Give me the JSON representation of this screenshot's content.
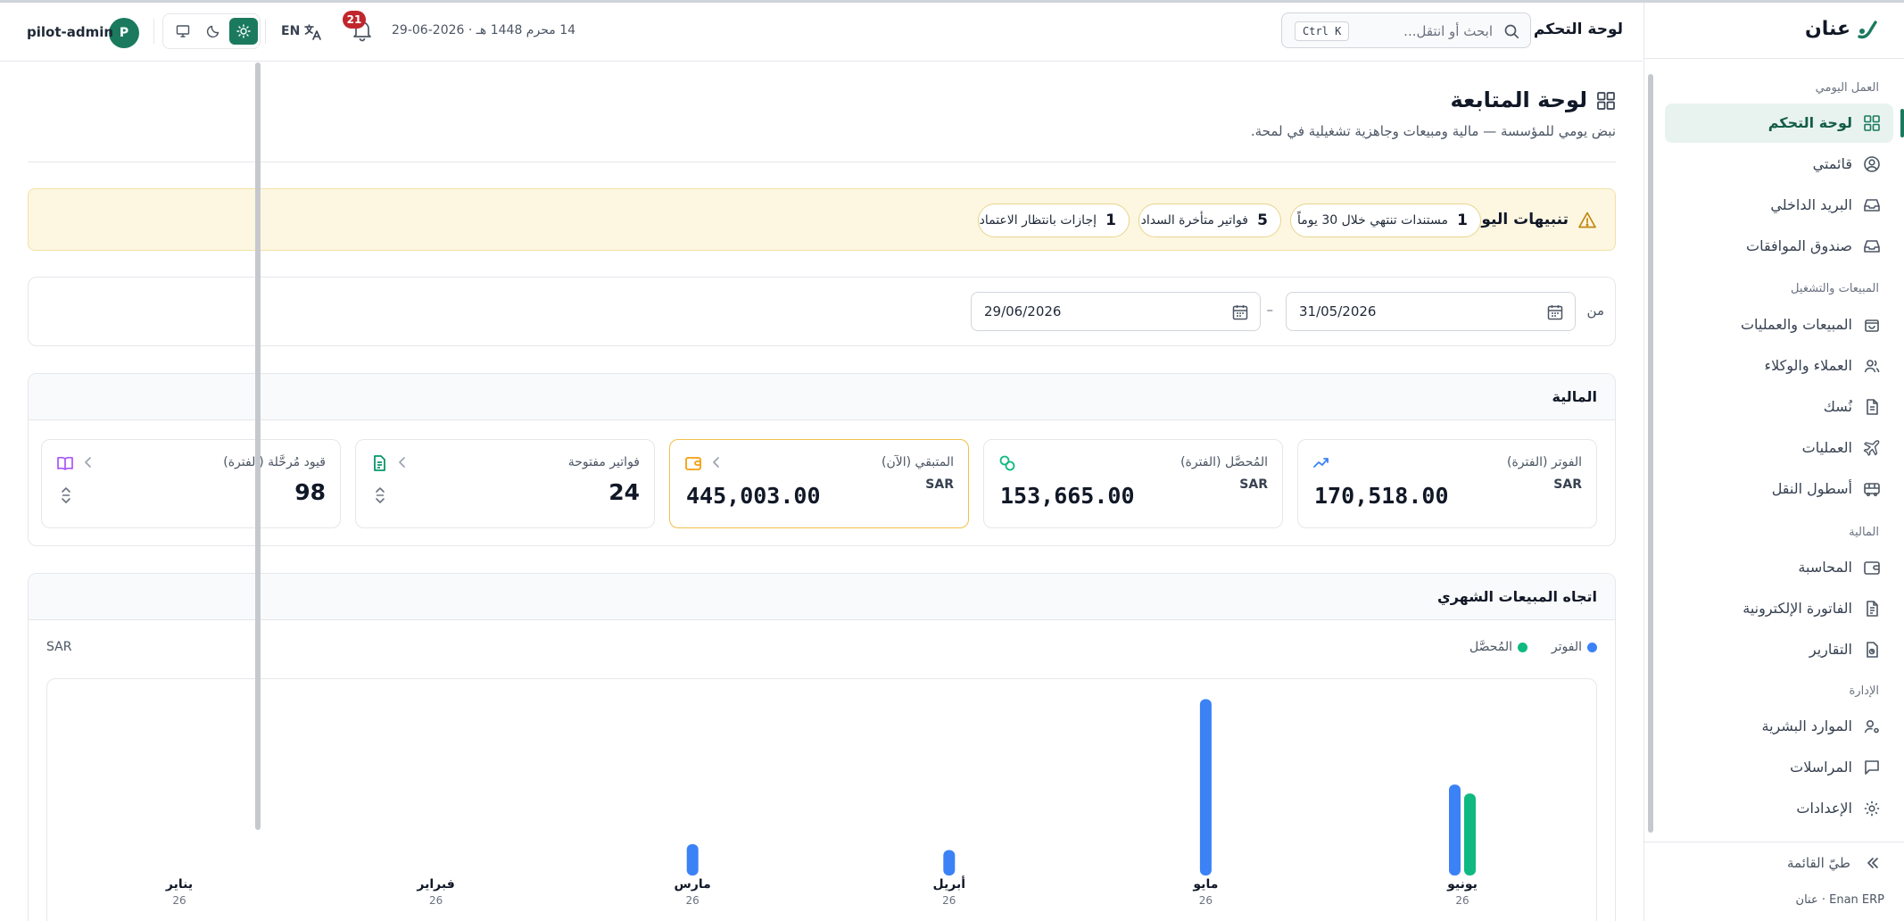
{
  "brand": {
    "name": "عنان",
    "footer": "Enan ERP · عنان"
  },
  "sidebar": {
    "sections": [
      {
        "title": "العمل اليومي",
        "items": [
          {
            "label": "لوحة التحكم",
            "icon": "dashboard-icon",
            "active": true
          },
          {
            "label": "قائمتي",
            "icon": "user-circle-icon"
          },
          {
            "label": "البريد الداخلي",
            "icon": "inbox-icon"
          },
          {
            "label": "صندوق الموافقات",
            "icon": "approvals-icon"
          }
        ]
      },
      {
        "title": "المبيعات والتشغيل",
        "items": [
          {
            "label": "المبيعات والعمليات",
            "icon": "shopping-bag-icon"
          },
          {
            "label": "العملاء والوكلاء",
            "icon": "users-icon"
          },
          {
            "label": "نُسك",
            "icon": "document-icon"
          },
          {
            "label": "العمليات",
            "icon": "plane-icon"
          },
          {
            "label": "أسطول النقل",
            "icon": "bus-icon"
          }
        ]
      },
      {
        "title": "المالية",
        "items": [
          {
            "label": "المحاسبة",
            "icon": "wallet-icon"
          },
          {
            "label": "الفاتورة الإلكترونية",
            "icon": "invoice-icon"
          },
          {
            "label": "التقارير",
            "icon": "report-icon"
          }
        ]
      },
      {
        "title": "الإدارة",
        "items": [
          {
            "label": "الموارد البشرية",
            "icon": "user-gear-icon"
          },
          {
            "label": "المراسلات",
            "icon": "message-icon"
          },
          {
            "label": "الإعدادات",
            "icon": "settings-icon"
          }
        ]
      }
    ],
    "collapse_label": "طيّ القائمة"
  },
  "topbar": {
    "breadcrumb": "لوحة التحكم",
    "search": {
      "placeholder": "ابحث أو انتقل...",
      "shortcut": "Ctrl K"
    },
    "date": "14 محرم 1448 هـ · 2026-06-29",
    "notifications": "21",
    "language": "EN",
    "theme_active": "light",
    "user": {
      "initial": "P",
      "name": "pilot-admin"
    }
  },
  "page": {
    "title": "لوحة المتابعة",
    "subtitle": "نبض يومي للمؤسسة — مالية ومبيعات وجاهزية تشغيلية في لمحة."
  },
  "alerts": {
    "title": "تنبيهات اليوم",
    "items": [
      {
        "count": "1",
        "label": "مستندات تنتهي خلال 30 يوماً"
      },
      {
        "count": "5",
        "label": "فواتير متأخرة السداد"
      },
      {
        "count": "1",
        "label": "إجازات بانتظار الاعتماد"
      }
    ]
  },
  "filter": {
    "from_label": "من",
    "from": "31/05/2026",
    "to": "29/06/2026",
    "dash": "–"
  },
  "finance": {
    "title": "المالية",
    "kpis": [
      {
        "label": "الفوتر (الفترة)",
        "currency": "SAR",
        "value": "170,518.00",
        "icon": "trend-up-icon",
        "color": "#3b82f6"
      },
      {
        "label": "المُحصَّل (الفترة)",
        "currency": "SAR",
        "value": "153,665.00",
        "icon": "coins-icon",
        "color": "#10b981"
      },
      {
        "label": "المتبقي (الآن)",
        "currency": "SAR",
        "value": "445,003.00",
        "icon": "wallet-icon",
        "color": "#f59e0b"
      },
      {
        "label": "فواتير مفتوحة",
        "currency": "",
        "value": "24",
        "icon": "invoice-icon",
        "color": "#059669"
      },
      {
        "label": "قيود مُرحَّلة (الفترة)",
        "currency": "",
        "value": "98",
        "icon": "book-icon",
        "color": "#a855f7"
      }
    ]
  },
  "chart_data": {
    "type": "bar",
    "title": "اتجاه المبيعات الشهري",
    "unit": "SAR",
    "categories": [
      "يناير",
      "فبراير",
      "مارس",
      "أبريل",
      "مايو",
      "يونيو"
    ],
    "category_sublabels": [
      "26",
      "26",
      "26",
      "26",
      "26",
      "26"
    ],
    "series": [
      {
        "name": "الفوتر",
        "color": "#3b82f6",
        "values": [
          0,
          0,
          35000,
          27000,
          230000,
          115000
        ]
      },
      {
        "name": "المُحصَّل",
        "color": "#10b981",
        "values": [
          0,
          0,
          0,
          0,
          0,
          103000
        ]
      }
    ],
    "ylim": [
      0,
      240000
    ],
    "grid": false,
    "legend_position": "top-right"
  }
}
